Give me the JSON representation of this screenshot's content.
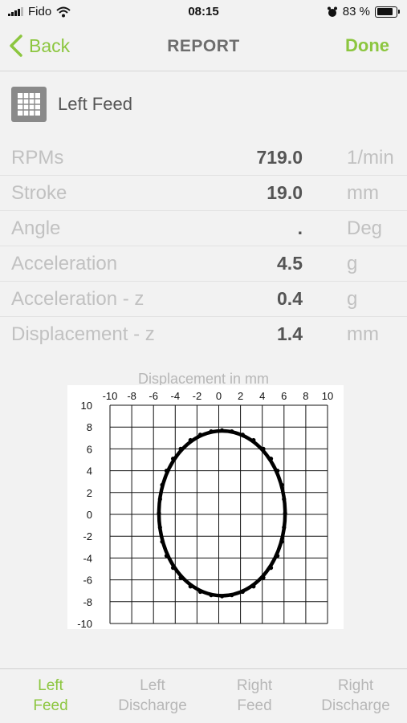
{
  "status": {
    "carrier": "Fido",
    "time": "08:15",
    "battery": "83 %",
    "battery_level": 0.83
  },
  "nav": {
    "back": "Back",
    "title": "REPORT",
    "done": "Done"
  },
  "section": {
    "title": "Left Feed",
    "icon": "grid-icon"
  },
  "params": [
    {
      "label": "RPMs",
      "value": "719.0",
      "unit": "1/min"
    },
    {
      "label": "Stroke",
      "value": "19.0",
      "unit": "mm"
    },
    {
      "label": "Angle",
      "value": ".",
      "unit": "Deg"
    },
    {
      "label": "Acceleration",
      "value": "4.5",
      "unit": "g"
    },
    {
      "label": "Acceleration - z",
      "value": "0.4",
      "unit": "g"
    },
    {
      "label": "Displacement - z",
      "value": "1.4",
      "unit": "mm"
    }
  ],
  "chart_data": {
    "type": "scatter",
    "title": "Displacement in mm",
    "xlabel": "",
    "ylabel": "",
    "xlim": [
      -10,
      10
    ],
    "ylim": [
      -10,
      10
    ],
    "x_ticks": [
      "-10",
      "-8",
      "-6",
      "-4",
      "-2",
      "0",
      "2",
      "4",
      "6",
      "8",
      "10"
    ],
    "y_ticks": [
      "10",
      "8",
      "6",
      "4",
      "2",
      "0",
      "-2",
      "-4",
      "-6",
      "-8",
      "-10"
    ],
    "grid": true,
    "series": [
      {
        "color": "#000000",
        "shape": "ellipse",
        "center": [
          0.3,
          0.1
        ],
        "radius_x": 5.8,
        "radius_y": 7.55,
        "points": [
          [
            6.1,
            0.1
          ],
          [
            6.0,
            1.4
          ],
          [
            5.8,
            2.7
          ],
          [
            5.4,
            4.0
          ],
          [
            4.8,
            5.1
          ],
          [
            4.1,
            6.0
          ],
          [
            3.2,
            6.8
          ],
          [
            2.2,
            7.3
          ],
          [
            1.2,
            7.6
          ],
          [
            0.3,
            7.7
          ],
          [
            -0.7,
            7.6
          ],
          [
            -1.7,
            7.3
          ],
          [
            -2.6,
            6.8
          ],
          [
            -3.5,
            6.0
          ],
          [
            -4.2,
            5.1
          ],
          [
            -4.8,
            4.0
          ],
          [
            -5.2,
            2.7
          ],
          [
            -5.4,
            1.4
          ],
          [
            -5.5,
            0.1
          ],
          [
            -5.4,
            -1.2
          ],
          [
            -5.2,
            -2.5
          ],
          [
            -4.8,
            -3.8
          ],
          [
            -4.2,
            -4.9
          ],
          [
            -3.5,
            -5.8
          ],
          [
            -2.6,
            -6.6
          ],
          [
            -1.7,
            -7.1
          ],
          [
            -0.7,
            -7.4
          ],
          [
            0.3,
            -7.5
          ],
          [
            1.2,
            -7.4
          ],
          [
            2.2,
            -7.1
          ],
          [
            3.2,
            -6.6
          ],
          [
            4.1,
            -5.8
          ],
          [
            4.8,
            -4.9
          ],
          [
            5.4,
            -3.8
          ],
          [
            5.8,
            -2.5
          ],
          [
            6.0,
            -1.2
          ]
        ]
      }
    ]
  },
  "tabs": [
    {
      "line1": "Left",
      "line2": "Feed",
      "active": true
    },
    {
      "line1": "Left",
      "line2": "Discharge",
      "active": false
    },
    {
      "line1": "Right",
      "line2": "Feed",
      "active": false
    },
    {
      "line1": "Right",
      "line2": "Discharge",
      "active": false
    }
  ],
  "colors": {
    "accent": "#8cc63f",
    "label_gray": "#c1c1c1",
    "value_gray": "#555555"
  }
}
